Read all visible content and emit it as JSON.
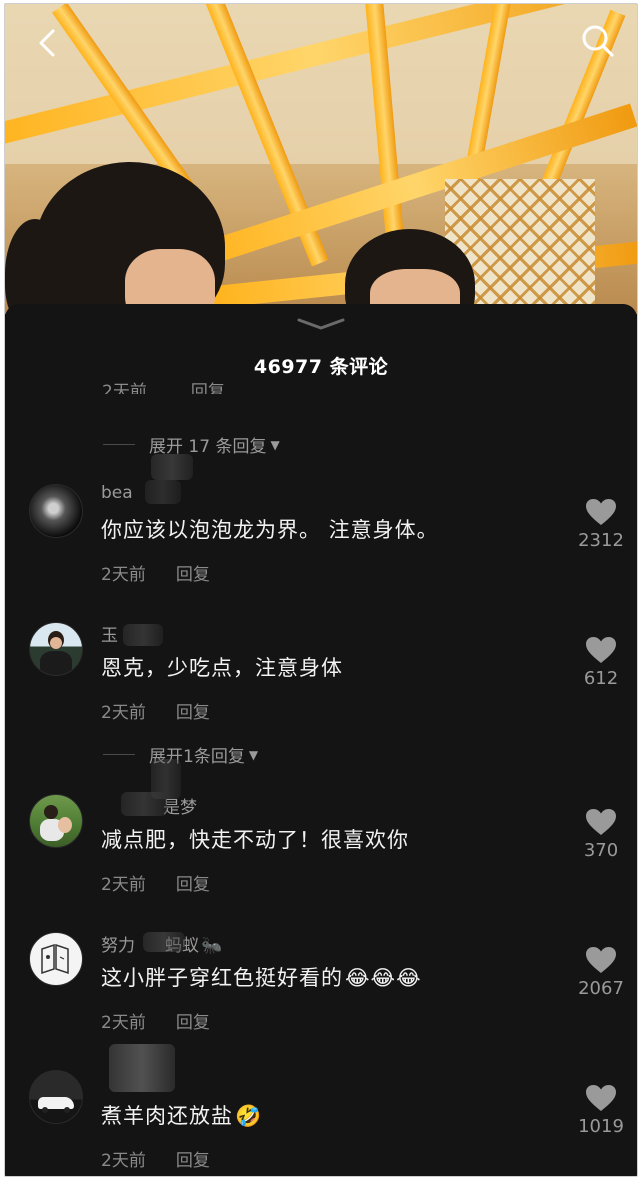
{
  "header": {
    "back_icon": "back-arrow-icon",
    "search_icon": "search-icon"
  },
  "sheet": {
    "title": "46977 条评论",
    "clipped_meta": {
      "time": "2天前",
      "reply": "回复"
    }
  },
  "expand_replies": [
    {
      "label": "展开 17 条回复"
    },
    {
      "label": "展开1条回复"
    }
  ],
  "comments": [
    {
      "user": "bea",
      "text": "你应该以泡泡龙为界。 注意身体。",
      "time": "2天前",
      "reply": "回复",
      "likes": "2312",
      "avatar": "dark-portrait"
    },
    {
      "user": "玉",
      "text": "恩克，少吃点，注意身体",
      "time": "2天前",
      "reply": "回复",
      "likes": "612",
      "avatar": "woman-portrait"
    },
    {
      "user": "是梦",
      "text": "减点肥，快走不动了！很喜欢你",
      "time": "2天前",
      "reply": "回复",
      "likes": "370",
      "avatar": "green-outdoor"
    },
    {
      "user": "努力",
      "user_suffix": "蚂蚁",
      "text": "这小胖子穿红色挺好看的",
      "emojis": "😂😂😂",
      "time": "2天前",
      "reply": "回复",
      "likes": "2067",
      "avatar": "sketch-book"
    },
    {
      "user": "",
      "text": "煮羊肉还放盐",
      "emojis": "🤣",
      "time": "2天前",
      "reply": "回复",
      "likes": "1019",
      "avatar": "white-car"
    }
  ],
  "colors": {
    "sheet_bg": "#141414",
    "primary_text": "#f2f2f2",
    "secondary_text": "#8a8a8a",
    "like_icon": "#9a9a9a"
  }
}
